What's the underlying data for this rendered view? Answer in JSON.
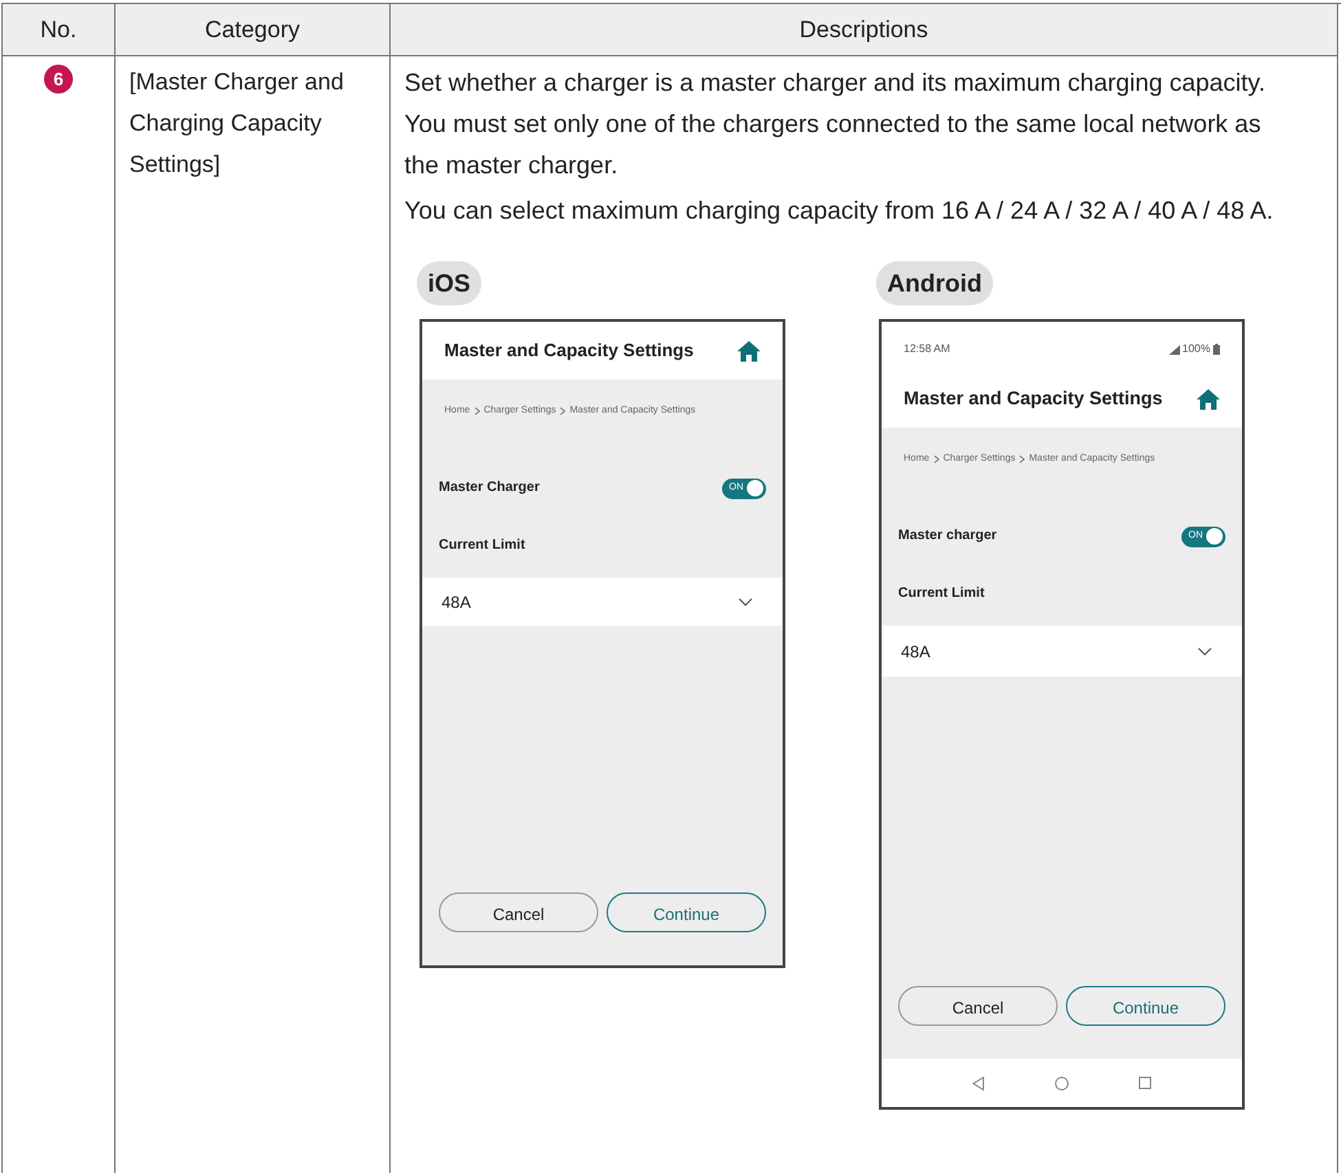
{
  "table": {
    "columns": [
      "No.",
      "Category",
      "Descriptions"
    ],
    "rows": [
      {
        "number": "6",
        "category": "[Master Charger and Charging Capacity Settings]",
        "descriptions": [
          "Set whether a charger is a master charger and its maximum charging capacity. You must set only one of the chargers connected to the same local network as the master charger.",
          "You can select maximum charging capacity from 16 A / 24 A / 32 A / 40 A / 48 A."
        ],
        "screens": [
          {
            "kind": "ios",
            "label": "iOS",
            "title": "Master and Capacity Settings",
            "breadcrumb": [
              "Home",
              "Charger Settings",
              "Master and Capacity Settings"
            ],
            "toggle_label": "Master Charger",
            "toggle": {
              "on": true,
              "text": "ON"
            },
            "limit_label": "Current Limit",
            "limit_value": "48A",
            "buttons": [
              "Cancel",
              "Continue"
            ]
          },
          {
            "kind": "android",
            "label": "Android",
            "status_time": "12:58 AM",
            "battery": "100%",
            "title": "Master and Capacity Settings",
            "breadcrumb": [
              "Home",
              "Charger Settings",
              "Master and Capacity Settings"
            ],
            "toggle_label": "Master charger",
            "toggle": {
              "on": true,
              "text": "ON"
            },
            "limit_label": "Current Limit",
            "limit_value": "48A",
            "buttons": [
              "Cancel",
              "Continue"
            ]
          }
        ]
      }
    ]
  }
}
